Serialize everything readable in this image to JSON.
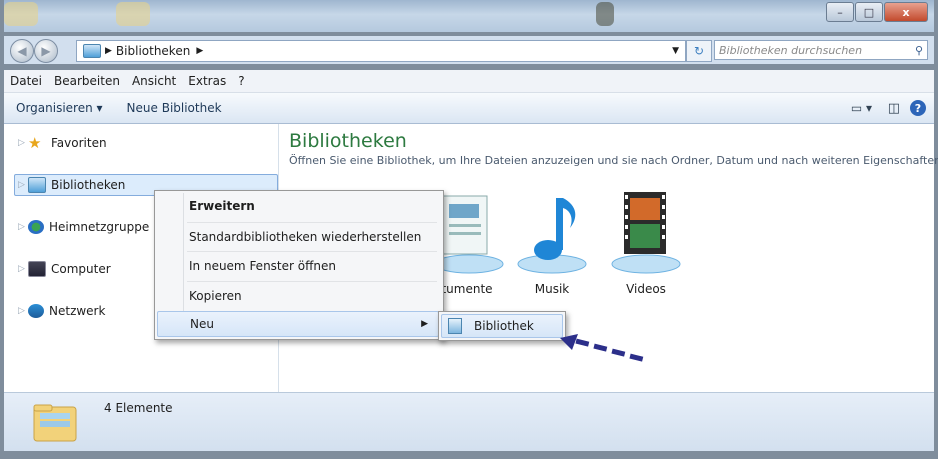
{
  "window": {
    "controls": {
      "minimize": "–",
      "maximize": "□",
      "close": "x"
    }
  },
  "address": {
    "path_label": "Bibliotheken",
    "search_placeholder": "Bibliotheken durchsuchen"
  },
  "menu": [
    "Datei",
    "Bearbeiten",
    "Ansicht",
    "Extras",
    "?"
  ],
  "commands": {
    "organize": "Organisieren ▾",
    "new_library": "Neue Bibliothek"
  },
  "nav": {
    "items": [
      {
        "label": "Favoriten",
        "icon": "star-icon"
      },
      {
        "label": "Bibliotheken",
        "icon": "library-icon"
      },
      {
        "label": "Heimnetzgruppe",
        "icon": "homegroup-icon"
      },
      {
        "label": "Computer",
        "icon": "computer-icon"
      },
      {
        "label": "Netzwerk",
        "icon": "network-icon"
      }
    ]
  },
  "content": {
    "title": "Bibliotheken",
    "description": "Öffnen Sie eine Bibliothek, um Ihre Dateien anzuzeigen und sie nach Ordner, Datum und nach weiteren Eigenschaften...",
    "libraries": [
      {
        "label": "tumente",
        "icon": "documents-icon"
      },
      {
        "label": "Musik",
        "icon": "music-icon"
      },
      {
        "label": "Videos",
        "icon": "videos-icon"
      }
    ]
  },
  "context_menu": {
    "items": [
      "Erweitern",
      "Standardbibliotheken wiederherstellen",
      "In neuem Fenster öffnen",
      "Kopieren",
      "Neu"
    ]
  },
  "submenu": {
    "item": "Bibliothek"
  },
  "status": {
    "count": "4 Elemente"
  },
  "colors": {
    "title_green": "#2d7a40",
    "annotation_arrow": "#2c2f8a"
  }
}
